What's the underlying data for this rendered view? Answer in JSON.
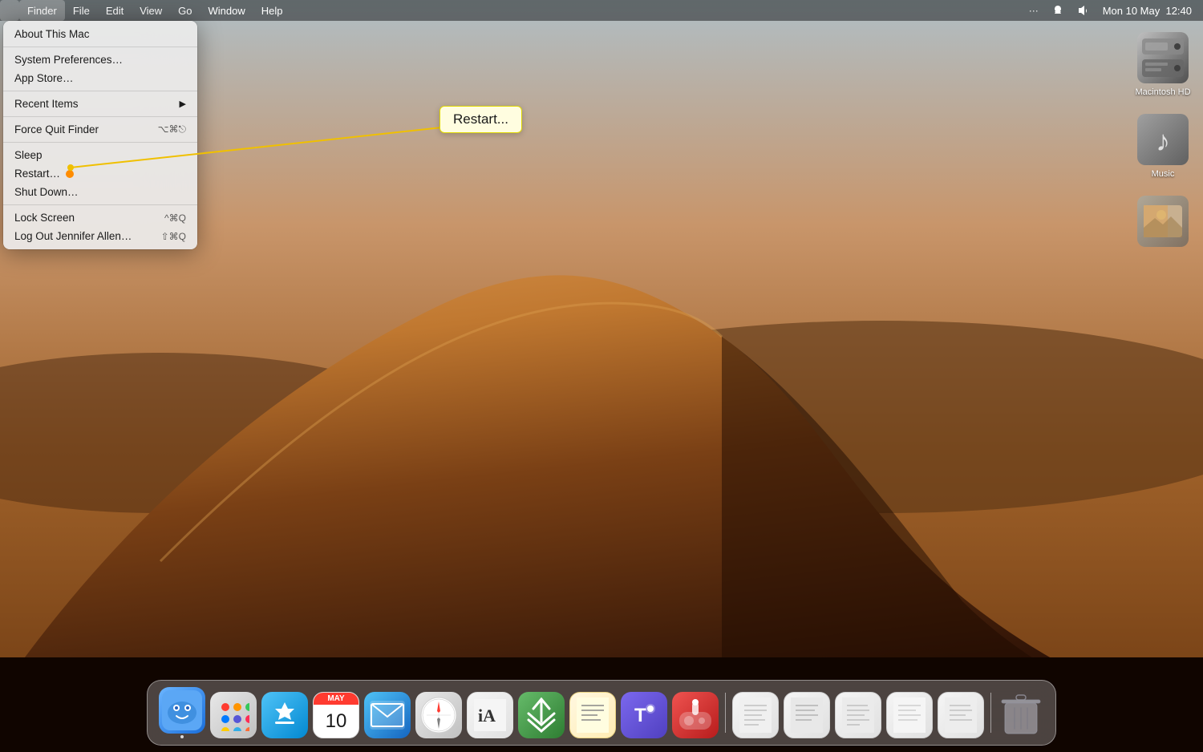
{
  "desktop": {
    "background_description": "macOS Mojave sand dunes"
  },
  "menubar": {
    "apple_symbol": "",
    "items": [
      "Finder",
      "File",
      "Edit",
      "View",
      "Go",
      "Window",
      "Help"
    ],
    "right_items": [
      "···",
      "📡",
      "🔊",
      "Mon 10 May",
      "12:40"
    ]
  },
  "apple_menu": {
    "items": [
      {
        "id": "about",
        "label": "About This Mac",
        "shortcut": "",
        "has_arrow": false,
        "separator_after": false
      },
      {
        "id": "sep1",
        "type": "separator"
      },
      {
        "id": "system_prefs",
        "label": "System Preferences…",
        "shortcut": "",
        "has_arrow": false,
        "separator_after": false
      },
      {
        "id": "app_store",
        "label": "App Store…",
        "shortcut": "",
        "has_arrow": false,
        "separator_after": false
      },
      {
        "id": "sep2",
        "type": "separator"
      },
      {
        "id": "recent_items",
        "label": "Recent Items",
        "shortcut": "",
        "has_arrow": true,
        "separator_after": false
      },
      {
        "id": "sep3",
        "type": "separator"
      },
      {
        "id": "force_quit",
        "label": "Force Quit Finder",
        "shortcut": "⌥⌘⎋",
        "has_arrow": false,
        "separator_after": false
      },
      {
        "id": "sep4",
        "type": "separator"
      },
      {
        "id": "sleep",
        "label": "Sleep",
        "shortcut": "",
        "has_arrow": false,
        "separator_after": false
      },
      {
        "id": "restart",
        "label": "Restart…",
        "shortcut": "",
        "has_arrow": false,
        "separator_after": false
      },
      {
        "id": "shutdown",
        "label": "Shut Down…",
        "shortcut": "",
        "has_arrow": false,
        "separator_after": false
      },
      {
        "id": "sep5",
        "type": "separator"
      },
      {
        "id": "lock_screen",
        "label": "Lock Screen",
        "shortcut": "^⌘Q",
        "has_arrow": false,
        "separator_after": false
      },
      {
        "id": "logout",
        "label": "Log Out Jennifer Allen…",
        "shortcut": "⇧⌘Q",
        "has_arrow": false,
        "separator_after": false
      }
    ]
  },
  "restart_tooltip": {
    "label": "Restart..."
  },
  "desktop_icons": [
    {
      "id": "macintosh_hd",
      "label": "Macintosh HD",
      "type": "hard_drive"
    },
    {
      "id": "music",
      "label": "Music",
      "type": "music"
    },
    {
      "id": "preview_img",
      "label": "",
      "type": "image"
    }
  ],
  "dock": {
    "items": [
      {
        "id": "finder",
        "label": "Finder",
        "type": "finder",
        "has_dot": true
      },
      {
        "id": "launchpad",
        "label": "Launchpad",
        "type": "launchpad",
        "has_dot": false
      },
      {
        "id": "appstore",
        "label": "App Store",
        "type": "appstore",
        "has_dot": false
      },
      {
        "id": "calendar",
        "label": "Calendar",
        "type": "calendar",
        "has_dot": false
      },
      {
        "id": "mail",
        "label": "Mail",
        "type": "mail",
        "has_dot": false
      },
      {
        "id": "safari",
        "label": "Safari",
        "type": "safari",
        "has_dot": false
      },
      {
        "id": "iawriter",
        "label": "iA Writer",
        "type": "iawriter",
        "has_dot": false
      },
      {
        "id": "keka",
        "label": "Keka",
        "type": "keka",
        "has_dot": false
      },
      {
        "id": "textedit",
        "label": "TextEdit",
        "type": "textedit",
        "has_dot": false
      },
      {
        "id": "teams",
        "label": "Microsoft Teams",
        "type": "teams",
        "has_dot": false
      },
      {
        "id": "joystick",
        "label": "Joystick Doctor",
        "type": "joystick",
        "has_dot": false
      },
      {
        "id": "scripts1",
        "label": "Script Editor",
        "type": "scripts",
        "has_dot": false
      },
      {
        "id": "scripts2",
        "label": "Scripts",
        "type": "scripts2",
        "has_dot": false
      },
      {
        "id": "scripts3",
        "label": "Scripts",
        "type": "scripts3",
        "has_dot": false
      },
      {
        "id": "scripts4",
        "label": "Scripts",
        "type": "scripts4",
        "has_dot": false
      },
      {
        "id": "scripts5",
        "label": "Scripts",
        "type": "scripts5",
        "has_dot": false
      },
      {
        "id": "trash",
        "label": "Trash",
        "type": "trash",
        "has_dot": false
      }
    ]
  }
}
